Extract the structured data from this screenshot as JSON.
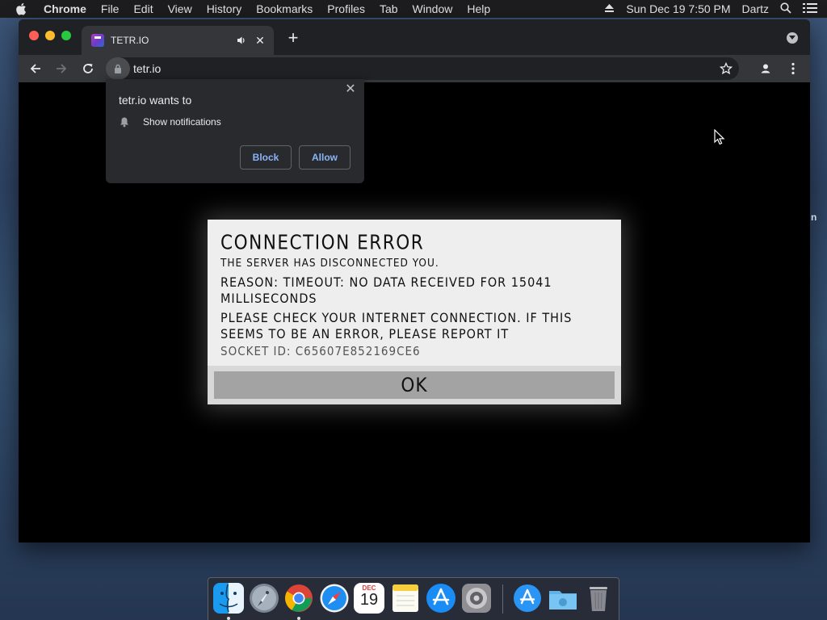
{
  "menubar": {
    "app_name": "Chrome",
    "menus": [
      "File",
      "Edit",
      "View",
      "History",
      "Bookmarks",
      "Profiles",
      "Tab",
      "Window",
      "Help"
    ],
    "datetime": "Sun Dec 19  7:50 PM",
    "user": "Dartz"
  },
  "browser": {
    "tab_title": "TETR.IO",
    "url": "tetr.io"
  },
  "permission_prompt": {
    "title": "tetr.io wants to",
    "permission": "Show notifications",
    "block_label": "Block",
    "allow_label": "Allow"
  },
  "error_dialog": {
    "title": "CONNECTION ERROR",
    "line1": "THE SERVER HAS DISCONNECTED YOU.",
    "reason": "REASON: TIMEOUT: NO DATA RECEIVED FOR 15041 MILLISECONDS",
    "check": "PLEASE CHECK YOUR INTERNET CONNECTION. IF THIS SEEMS TO BE AN ERROR, PLEASE REPORT IT",
    "socket_id": "SOCKET ID: C65607E852169CE6",
    "ok_label": "OK"
  },
  "edge_glyph": "n",
  "dock": {
    "calendar_month": "DEC",
    "calendar_day": "19",
    "apps": [
      "finder-icon",
      "launchpad-icon",
      "chrome-icon",
      "safari-icon",
      "calendar-icon",
      "notes-icon",
      "app-store-icon",
      "system-preferences-icon",
      "app-store-folder-icon",
      "downloads-folder-icon",
      "trash-icon"
    ]
  }
}
